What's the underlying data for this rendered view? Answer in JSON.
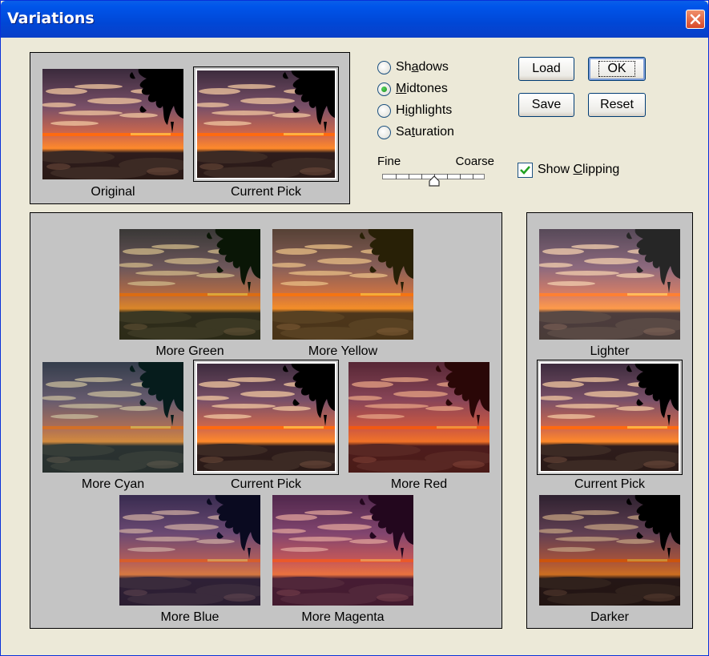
{
  "window": {
    "title": "Variations"
  },
  "top_panel": {
    "original_label": "Original",
    "current_pick_label": "Current Pick"
  },
  "tonal_options": [
    {
      "label": "Shadows",
      "access_key": "a",
      "selected": false
    },
    {
      "label": "Midtones",
      "access_key": "M",
      "selected": true
    },
    {
      "label": "Highlights",
      "access_key": "i",
      "selected": false
    },
    {
      "label": "Saturation",
      "access_key": "t",
      "selected": false
    }
  ],
  "slider": {
    "fine_label": "Fine",
    "coarse_label": "Coarse",
    "value_fraction": 0.5
  },
  "buttons": {
    "load": "Load",
    "ok": "OK",
    "save": "Save",
    "reset": "Reset"
  },
  "show_clipping": {
    "label": "Show Clipping",
    "access_key": "C",
    "checked": true
  },
  "color_variations": {
    "more_green": "More Green",
    "more_yellow": "More Yellow",
    "more_cyan": "More Cyan",
    "current_pick": "Current Pick",
    "more_red": "More Red",
    "more_blue": "More Blue",
    "more_magenta": "More Magenta"
  },
  "brightness_variations": {
    "lighter": "Lighter",
    "current_pick": "Current Pick",
    "darker": "Darker"
  },
  "colors": {
    "titlebar": "#0054e3",
    "dialog_bg": "#ece9d8",
    "panel_bg": "#c4c4c4"
  }
}
